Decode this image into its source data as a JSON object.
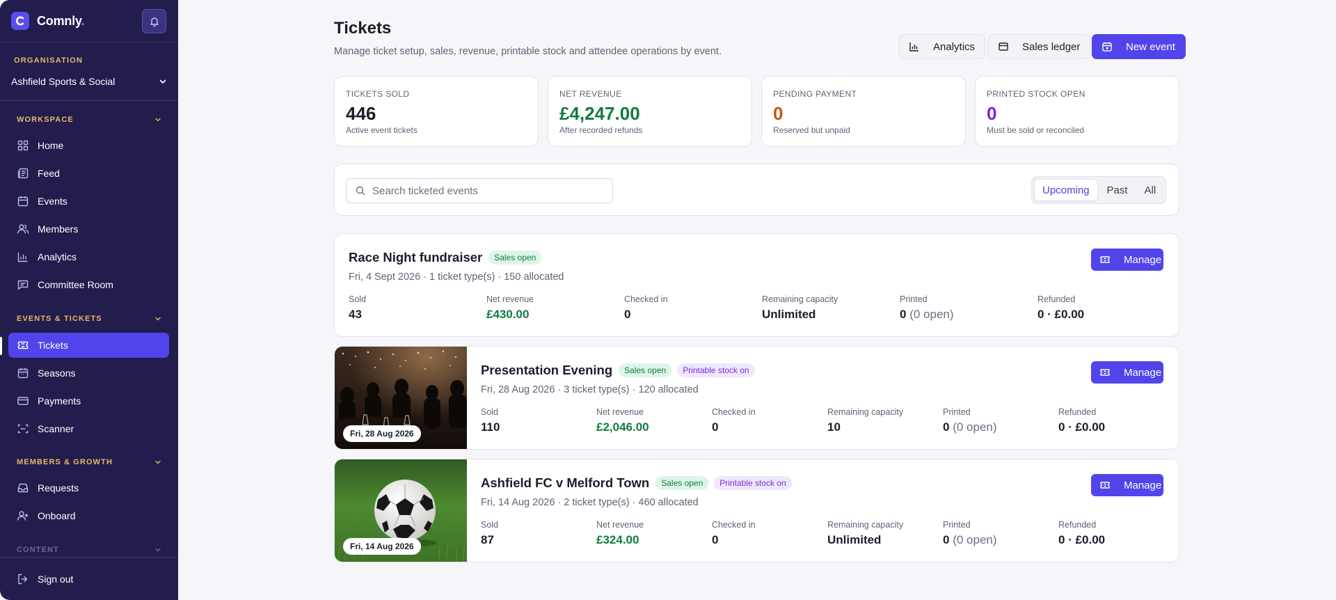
{
  "sidebar": {
    "brand": {
      "name": "Comnly",
      "dot": ".",
      "logo_letter": "C"
    },
    "organisation": {
      "label": "ORGANISATION",
      "value": "Ashfield Sports & Social"
    },
    "sections": {
      "workspace": "WORKSPACE",
      "events_tickets": "EVENTS & TICKETS",
      "members_growth": "MEMBERS & GROWTH",
      "content": "CONTENT"
    },
    "items": {
      "home": "Home",
      "feed": "Feed",
      "events": "Events",
      "members": "Members",
      "analytics": "Analytics",
      "committee_room": "Committee Room",
      "tickets": "Tickets",
      "seasons": "Seasons",
      "payments": "Payments",
      "scanner": "Scanner",
      "requests": "Requests",
      "onboard": "Onboard"
    },
    "sign_out": "Sign out",
    "active_item": "Tickets"
  },
  "header": {
    "title": "Tickets",
    "subtitle": "Manage ticket setup, sales, revenue, printable stock and attendee operations by event.",
    "buttons": {
      "analytics": "Analytics",
      "sales_ledger": "Sales ledger",
      "new_event": "New event"
    }
  },
  "stats": [
    {
      "label": "TICKETS SOLD",
      "value": "446",
      "note": "Active event tickets",
      "color": "#1b1d2b"
    },
    {
      "label": "NET REVENUE",
      "value": "£4,247.00",
      "note": "After recorded refunds",
      "color": "#137a44"
    },
    {
      "label": "PENDING PAYMENT",
      "value": "0",
      "note": "Reserved but unpaid",
      "color": "#c2570c"
    },
    {
      "label": "PRINTED STOCK OPEN",
      "value": "0",
      "note": "Must be sold or reconciled",
      "color": "#7a22e0"
    }
  ],
  "filters": {
    "search_placeholder": "Search ticketed events",
    "search_value": "",
    "tabs": [
      "Upcoming",
      "Past",
      "All"
    ],
    "active_tab": "Upcoming"
  },
  "column_labels": {
    "sold": "Sold",
    "net_revenue": "Net revenue",
    "checked_in": "Checked in",
    "remaining": "Remaining capacity",
    "printed": "Printed",
    "refunded": "Refunded"
  },
  "manage_label": "Manage",
  "events": [
    {
      "title": "Race Night fundraiser",
      "badges": [
        "Sales open"
      ],
      "meta": "Fri, 4 Sept 2026 · 1 ticket type(s) · 150 allocated",
      "date_chip": "",
      "image": "none",
      "sold": "43",
      "net_revenue": "£430.00",
      "checked_in": "0",
      "remaining": "Unlimited",
      "printed": "0",
      "printed_open": "(0 open)",
      "refunded": "0 · £0.00"
    },
    {
      "title": "Presentation Evening",
      "badges": [
        "Sales open",
        "Printable stock on"
      ],
      "meta": "Fri, 28 Aug 2026 · 3 ticket type(s) · 120 allocated",
      "date_chip": "Fri, 28 Aug 2026",
      "image": "evening-crowd-photo",
      "sold": "110",
      "net_revenue": "£2,046.00",
      "checked_in": "0",
      "remaining": "10",
      "printed": "0",
      "printed_open": "(0 open)",
      "refunded": "0 · £0.00"
    },
    {
      "title": "Ashfield FC v Melford Town",
      "badges": [
        "Sales open",
        "Printable stock on"
      ],
      "meta": "Fri, 14 Aug 2026 · 2 ticket type(s) · 460 allocated",
      "date_chip": "Fri, 14 Aug 2026",
      "image": "football-on-grass-photo",
      "sold": "87",
      "net_revenue": "£324.00",
      "checked_in": "0",
      "remaining": "Unlimited",
      "printed": "0",
      "printed_open": "(0 open)",
      "refunded": "0 · £0.00"
    }
  ],
  "colors": {
    "sidebar_bg": "#221d4d",
    "accent": "#5144ea",
    "section_label": "#e8b86a",
    "revenue_green": "#137a44",
    "pending_orange": "#c2570c",
    "printed_purple": "#7a22e0"
  }
}
